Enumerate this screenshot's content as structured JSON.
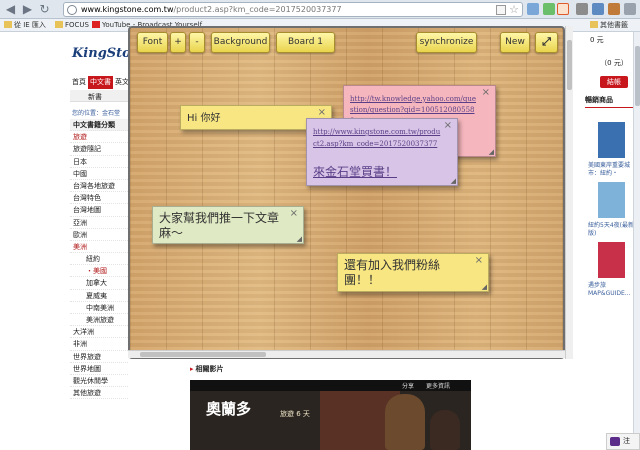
{
  "browser": {
    "url_domain": "www.kingstone.com.tw",
    "url_path": "/product2.asp?km_code=2017520037377"
  },
  "bookmarks": [
    "從 IE 匯入",
    "FOCUS",
    "YouTube - Broadcast Yourself",
    "其他書籤"
  ],
  "page": {
    "logo": "KingSton",
    "topnav": [
      "首頁",
      "中文書",
      "英文"
    ],
    "category_bar": "新書",
    "breadcrumb": "您的位置：金石堂",
    "sidebar": [
      {
        "label": "中文書籍分類",
        "style": "head"
      },
      {
        "label": "旅遊",
        "style": "red"
      },
      {
        "label": "旅遊隨記",
        "style": ""
      },
      {
        "label": "日本",
        "style": ""
      },
      {
        "label": "中國",
        "style": ""
      },
      {
        "label": "台灣各地旅遊",
        "style": ""
      },
      {
        "label": "台灣特色",
        "style": ""
      },
      {
        "label": "台灣地圖",
        "style": ""
      },
      {
        "label": "亞洲",
        "style": ""
      },
      {
        "label": "歐洲",
        "style": ""
      },
      {
        "label": "美洲",
        "style": "red"
      },
      {
        "label": "紐約",
        "style": "sub"
      },
      {
        "label": "・美國",
        "style": "sub red"
      },
      {
        "label": "加拿大",
        "style": "sub"
      },
      {
        "label": "夏威夷",
        "style": "sub"
      },
      {
        "label": "中南美洲",
        "style": "sub"
      },
      {
        "label": "美洲旅遊",
        "style": "sub"
      },
      {
        "label": "大洋洲",
        "style": ""
      },
      {
        "label": "非洲",
        "style": ""
      },
      {
        "label": "世界旅遊",
        "style": ""
      },
      {
        "label": "世界地圖",
        "style": ""
      },
      {
        "label": "觀光休閒學",
        "style": ""
      },
      {
        "label": "其他旅遊",
        "style": ""
      }
    ],
    "related_video_title": "相關影片",
    "video": {
      "share": "分享",
      "more": "更多資訊",
      "title": "奧蘭多",
      "subtitle": "旅遊 6 天"
    },
    "cart": {
      "count": "0 元",
      "count2": "（0 元）",
      "checkout": "結帳"
    },
    "hot_title": "暢銷商品",
    "hot_books": [
      {
        "caption": "美國東岸重要城市：紐約・",
        "color": "#3a6fb0"
      },
      {
        "caption": "紐約5天4夜(最新版)",
        "color": "#7fb2d9"
      },
      {
        "caption": "遇步旅MAP&GUIDE...",
        "color": "#c8304a"
      }
    ],
    "chat_label": "注"
  },
  "board": {
    "buttons": {
      "font": "Font",
      "plus": "+",
      "minus": "-",
      "background": "Background",
      "board": "Board 1",
      "sync": "synchronize",
      "new": "New",
      "fullscreen": "⤢"
    },
    "notes": [
      {
        "id": "pink",
        "text": "http://tw.knowledge.yahoo.com/question/question?qid=1005120805588"
      },
      {
        "id": "yellow-small",
        "text": "Hi 你好"
      },
      {
        "id": "purple",
        "url": "http://www.kingstone.com.tw/product2.asp?km_code=2017520037377",
        "text": "來金石堂買書！"
      },
      {
        "id": "green",
        "text": "大家幫我們推一下文章麻～"
      },
      {
        "id": "yellow-big",
        "text": "還有加入我們粉絲團！！"
      }
    ],
    "close_glyph": "×",
    "resize_glyph": "◢"
  }
}
